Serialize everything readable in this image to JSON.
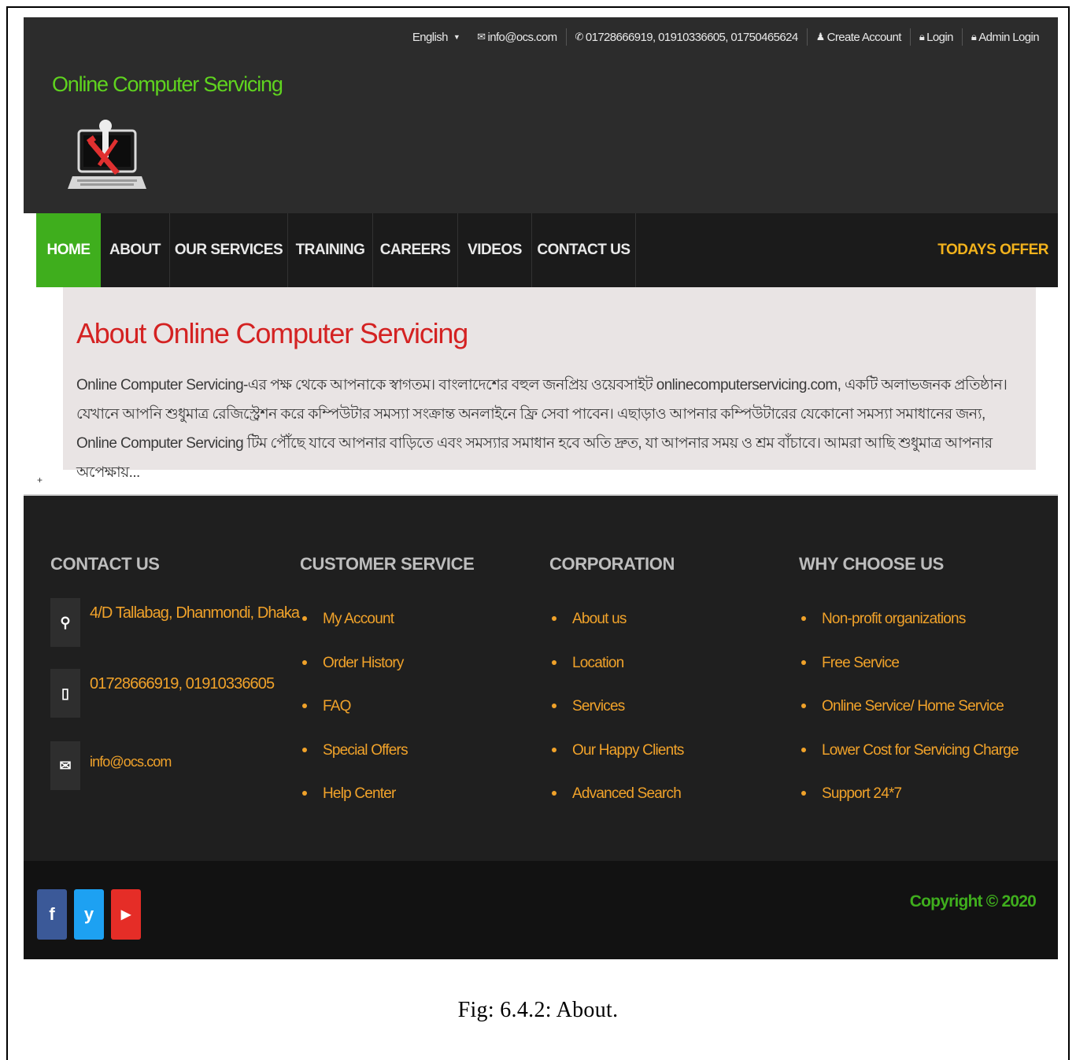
{
  "topbar": {
    "language": "English",
    "email": "info@ocs.com",
    "phones": "01728666919, 01910336605, 01750465624",
    "create_account": "Create Account",
    "login": "Login",
    "admin_login": "Admin Login"
  },
  "brand": {
    "name": "Online Computer Servicing"
  },
  "nav": {
    "items": [
      {
        "label": "HOME"
      },
      {
        "label": "ABOUT"
      },
      {
        "label": "OUR SERVICES"
      },
      {
        "label": "TRAINING"
      },
      {
        "label": "CAREERS"
      },
      {
        "label": "VIDEOS"
      },
      {
        "label": "CONTACT US"
      }
    ],
    "offer": "TODAYS OFFER"
  },
  "about": {
    "title": "About Online Computer Servicing",
    "body": "Online Computer Servicing-এর পক্ষ থেকে আপনাকে স্বাগতম। বাংলাদেশের বহুল জনপ্রিয় ওয়েবসাইট onlinecomputerservicing.com, একটি অলাভজনক প্রতিষ্ঠান। যেখানে আপনি শুধুমাত্র রেজিস্ট্রেশন করে কম্পিউটার সমস্যা সংক্রান্ত অনলাইনে ফ্রি সেবা পাবেন। এছাড়াও আপনার কম্পিউটারের যেকোনো সমস্যা সমাধানের জন্য, Online Computer Servicing টিম পৌঁছে যাবে আপনার বাড়িতে এবং সমস্যার সমাধান হবে অতি দ্রুত, যা আপনার সময় ও শ্রম বাঁচাবে। আমরা আছি শুধুমাত্র আপনার অপেক্ষায়..."
  },
  "footer": {
    "contact": {
      "heading": "CONTACT US",
      "address": "4/D Tallabag, Dhanmondi, Dhaka",
      "phone": "01728666919, 01910336605",
      "email": "info@ocs.com"
    },
    "customer_service": {
      "heading": "CUSTOMER SERVICE",
      "items": [
        "My Account",
        "Order History",
        "FAQ",
        "Special Offers",
        "Help Center"
      ]
    },
    "corporation": {
      "heading": "CORPORATION",
      "items": [
        "About us",
        "Location",
        "Services",
        "Our Happy Clients",
        "Advanced Search"
      ]
    },
    "why_choose": {
      "heading": "WHY CHOOSE US",
      "items": [
        "Non-profit organizations",
        "Free Service",
        "Online Service/ Home Service",
        "Lower Cost for Servicing Charge",
        "Support 24*7"
      ]
    },
    "copyright": "Copyright © 2020",
    "social": [
      {
        "icon": "facebook-icon",
        "glyph": "f",
        "color": "#3b5998"
      },
      {
        "icon": "twitter-icon",
        "glyph": "y",
        "color": "#1da1f2"
      },
      {
        "icon": "youtube-icon",
        "glyph": "▶",
        "color": "#e52d27"
      }
    ]
  },
  "caption": "Fig: 6.4.2:  About.",
  "colors": {
    "brand_green": "#5fd31f",
    "active_nav": "#3fae1d",
    "offer": "#f2b21c",
    "about_title": "#d42222",
    "footer_link": "#f0a22a"
  }
}
